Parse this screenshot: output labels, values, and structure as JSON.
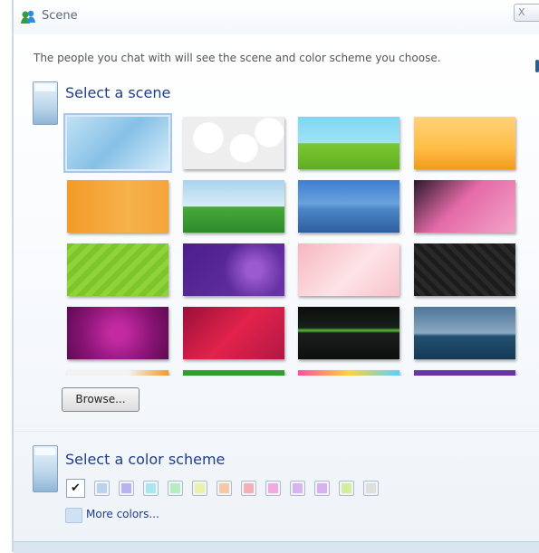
{
  "window": {
    "title": "Scene",
    "close_label": "X"
  },
  "description": "The people you chat with will see the scene and color scheme you choose.",
  "scene_section": {
    "title": "Select a scene"
  },
  "browse_label": "Browse...",
  "color_section": {
    "title": "Select a color scheme",
    "more_colors": "More colors..."
  },
  "scenes": [
    {
      "name": "scene-light-blue-sky",
      "selected": true
    },
    {
      "name": "scene-white-hearts"
    },
    {
      "name": "scene-sunny-meadow"
    },
    {
      "name": "scene-orange-tree"
    },
    {
      "name": "scene-orange-grass"
    },
    {
      "name": "scene-green-field-kite"
    },
    {
      "name": "scene-blue-city-skyline"
    },
    {
      "name": "scene-pink-floral"
    },
    {
      "name": "scene-green-stripes"
    },
    {
      "name": "scene-purple-swirls"
    },
    {
      "name": "scene-cherry-blossom"
    },
    {
      "name": "scene-dark-pattern"
    },
    {
      "name": "scene-magenta-heart"
    },
    {
      "name": "scene-red-rays"
    },
    {
      "name": "scene-dark-green-glow"
    },
    {
      "name": "scene-ocean-plane"
    }
  ],
  "color_swatches": [
    {
      "name": "swatch-default",
      "selected": true
    },
    {
      "color": "#b9d3ee"
    },
    {
      "color": "#b8b2f0"
    },
    {
      "color": "#a9e7f0"
    },
    {
      "color": "#b5ecc0"
    },
    {
      "color": "#e9f2a6"
    },
    {
      "color": "#f6c9a6"
    },
    {
      "color": "#f4aeb8"
    },
    {
      "color": "#f3a8e0"
    },
    {
      "color": "#d6b4f0"
    },
    {
      "color": "#d3ef9c"
    },
    {
      "color": "#dedede"
    }
  ]
}
